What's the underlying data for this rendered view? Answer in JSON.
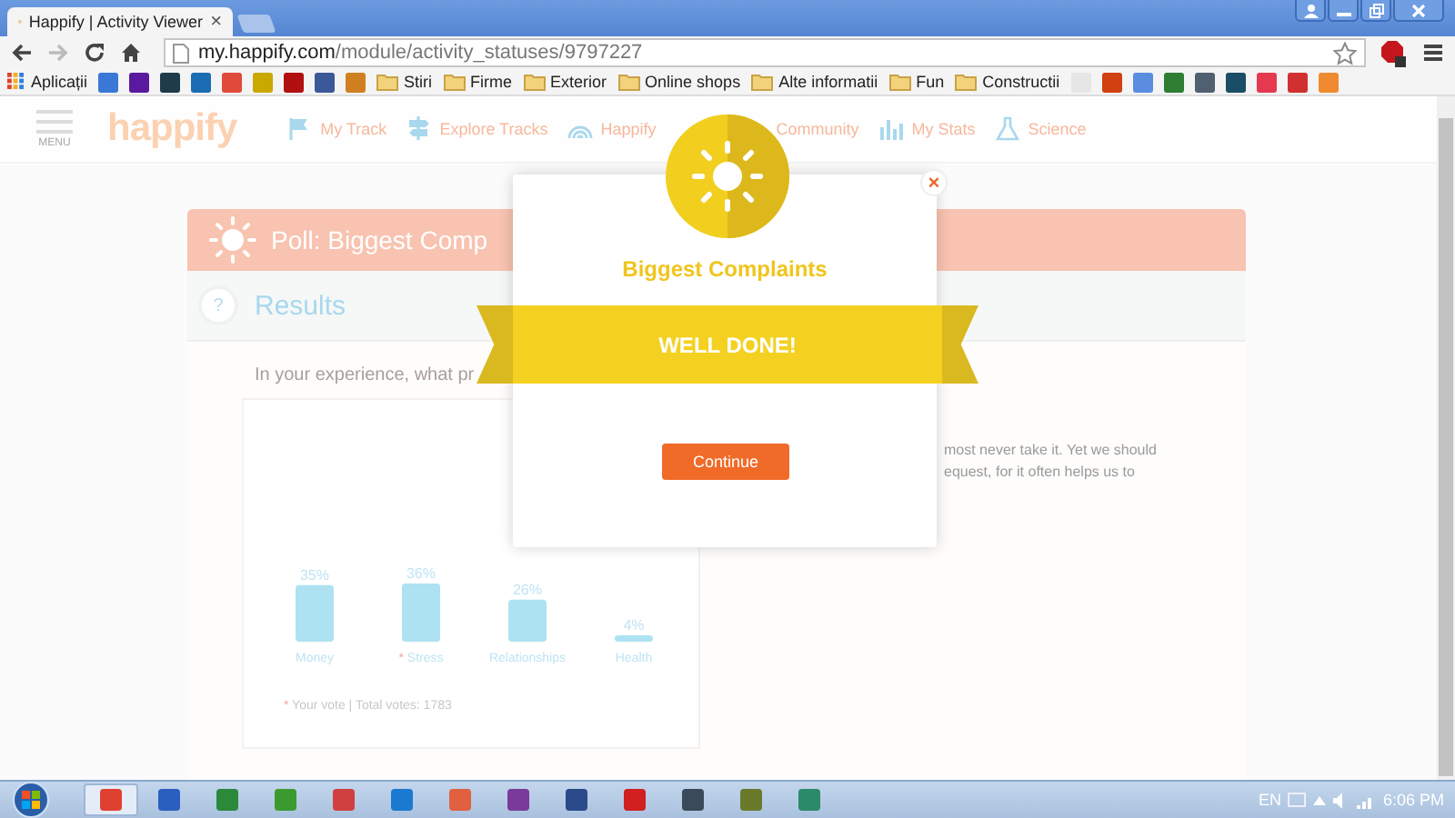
{
  "browser": {
    "tabs": [
      {
        "title": "Happify | Activity Viewer",
        "close": "×",
        "selected": true
      }
    ],
    "address": {
      "host": "my.happify.com",
      "path": "/module/activity_statuses/9797227"
    },
    "bookmarks": [
      {
        "kind": "apps",
        "label": "Aplicații"
      },
      {
        "kind": "icon",
        "color": "#3a78d8"
      },
      {
        "kind": "icon",
        "color": "#5a1aa0"
      },
      {
        "kind": "icon",
        "color": "#1f3b4a"
      },
      {
        "kind": "icon",
        "color": "#1b6db3"
      },
      {
        "kind": "icon",
        "color": "#e04a3a"
      },
      {
        "kind": "icon",
        "color": "#c9a800"
      },
      {
        "kind": "icon",
        "color": "#b01010"
      },
      {
        "kind": "icon",
        "color": "#3b5998"
      },
      {
        "kind": "icon",
        "color": "#d08020"
      },
      {
        "kind": "folder",
        "label": "Stiri"
      },
      {
        "kind": "folder",
        "label": "Firme"
      },
      {
        "kind": "folder",
        "label": "Exterior"
      },
      {
        "kind": "folder",
        "label": "Online shops"
      },
      {
        "kind": "folder",
        "label": "Alte informatii"
      },
      {
        "kind": "folder",
        "label": "Fun"
      },
      {
        "kind": "folder",
        "label": "Constructii"
      },
      {
        "kind": "icon",
        "color": "#e6e6e6"
      },
      {
        "kind": "icon",
        "color": "#d04010"
      },
      {
        "kind": "icon",
        "color": "#5a8de0"
      },
      {
        "kind": "icon",
        "color": "#2e7d32"
      },
      {
        "kind": "icon",
        "color": "#506070"
      },
      {
        "kind": "icon",
        "color": "#1a4d66"
      },
      {
        "kind": "icon",
        "color": "#e53950"
      },
      {
        "kind": "icon",
        "color": "#d03030"
      },
      {
        "kind": "icon",
        "color": "#f08a30"
      }
    ]
  },
  "page": {
    "menu_label": "MENU",
    "logo": "happify",
    "nav": [
      {
        "kind": "flag",
        "label": "My Track"
      },
      {
        "kind": "signpost",
        "label": "Explore Tracks"
      },
      {
        "kind": "arcs",
        "label": "Happify"
      },
      {
        "kind": "text",
        "label": "Community"
      },
      {
        "kind": "bars",
        "label": "My Stats"
      },
      {
        "kind": "flask",
        "label": "Science"
      }
    ],
    "poll": {
      "title": "Poll: Biggest Comp",
      "help": "?",
      "section": "Results",
      "question": "In your experience, what pr",
      "chart_data": {
        "type": "bar",
        "categories": [
          "Money",
          "Stress",
          "Relationships",
          "Health"
        ],
        "values": [
          35,
          36,
          26,
          4
        ],
        "value_labels": [
          "35%",
          "36%",
          "26%",
          "4%"
        ]
      },
      "voted": [
        false,
        true,
        false,
        false
      ],
      "vote_mark": "*",
      "footnote_mark": "*",
      "footnote": "Your vote | Total votes: 1783",
      "side_text": [
        "most never take it. Yet we should",
        "equest, for it often helps us to"
      ]
    }
  },
  "modal": {
    "title": "Biggest Complaints",
    "banner": "WELL DONE!",
    "button": "Continue",
    "close": "×"
  },
  "taskbar": {
    "apps": [
      {
        "color": "#e04030",
        "selected": true
      },
      {
        "color": "#2a5fc0",
        "selected": false
      },
      {
        "color": "#2a8a3a",
        "selected": false
      },
      {
        "color": "#3a9a30",
        "selected": false
      },
      {
        "color": "#d04040",
        "selected": false
      },
      {
        "color": "#1a7ad0",
        "selected": false
      },
      {
        "color": "#e06040",
        "selected": false
      },
      {
        "color": "#7a3a9a",
        "selected": false
      },
      {
        "color": "#2a4a8a",
        "selected": false
      },
      {
        "color": "#d02020",
        "selected": false
      },
      {
        "color": "#3a4a5a",
        "selected": false
      },
      {
        "color": "#6a7a2a",
        "selected": false
      },
      {
        "color": "#2a8a6a",
        "selected": false
      }
    ],
    "language": "EN",
    "time": "6:06 PM"
  }
}
